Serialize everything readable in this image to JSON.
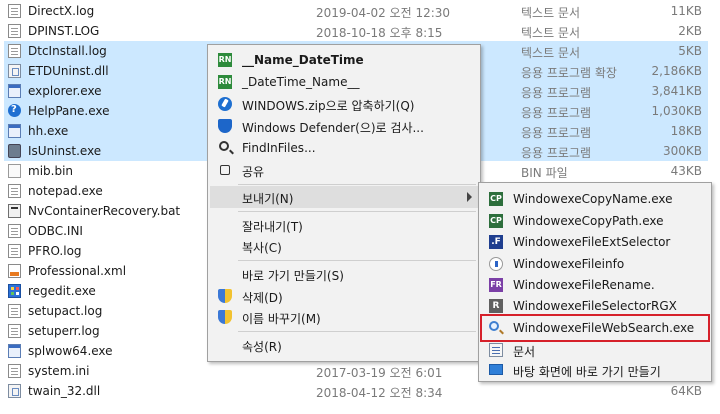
{
  "files": [
    {
      "name": "DirectX.log",
      "date": "2019-04-02 오전 12:30",
      "type": "텍스트 문서",
      "size": "11KB",
      "icon": "text-file-icon",
      "selected": false
    },
    {
      "name": "DPINST.LOG",
      "date": "2018-10-18 오후 8:15",
      "type": "텍스트 문서",
      "size": "2KB",
      "icon": "text-file-icon",
      "selected": false
    },
    {
      "name": "DtcInstall.log",
      "date": "",
      "type": "텍스트 문서",
      "size": "5KB",
      "icon": "text-file-icon",
      "selected": true
    },
    {
      "name": "ETDUninst.dll",
      "date": "",
      "type": "응용 프로그램 확장",
      "size": "2,186KB",
      "icon": "dll-file-icon",
      "selected": true
    },
    {
      "name": "explorer.exe",
      "date": "",
      "type": "응용 프로그램",
      "size": "3,841KB",
      "icon": "explorer-icon",
      "selected": true
    },
    {
      "name": "HelpPane.exe",
      "date": "",
      "type": "응용 프로그램",
      "size": "1,030KB",
      "icon": "help-icon",
      "selected": true
    },
    {
      "name": "hh.exe",
      "date": "",
      "type": "응용 프로그램",
      "size": "18KB",
      "icon": "exe-file-icon",
      "selected": true
    },
    {
      "name": "IsUninst.exe",
      "date": "",
      "type": "응용 프로그램",
      "size": "300KB",
      "icon": "setup-icon",
      "selected": true
    },
    {
      "name": "mib.bin",
      "date": "",
      "type": "BIN 파일",
      "size": "43KB",
      "icon": "bin-file-icon",
      "selected": false
    },
    {
      "name": "notepad.exe",
      "date": "",
      "type": "",
      "size": "",
      "icon": "notepad-icon",
      "selected": false
    },
    {
      "name": "NvContainerRecovery.bat",
      "date": "",
      "type": "",
      "size": "",
      "icon": "batch-file-icon",
      "selected": false
    },
    {
      "name": "ODBC.INI",
      "date": "",
      "type": "",
      "size": "",
      "icon": "config-file-icon",
      "selected": false
    },
    {
      "name": "PFRO.log",
      "date": "",
      "type": "",
      "size": "",
      "icon": "text-file-icon",
      "selected": false
    },
    {
      "name": "Professional.xml",
      "date": "",
      "type": "",
      "size": "",
      "icon": "xml-file-icon",
      "selected": false
    },
    {
      "name": "regedit.exe",
      "date": "",
      "type": "",
      "size": "",
      "icon": "regedit-icon",
      "selected": false
    },
    {
      "name": "setupact.log",
      "date": "",
      "type": "",
      "size": "",
      "icon": "text-file-icon",
      "selected": false
    },
    {
      "name": "setuperr.log",
      "date": "",
      "type": "",
      "size": "",
      "icon": "text-file-icon",
      "selected": false
    },
    {
      "name": "splwow64.exe",
      "date": "",
      "type": "",
      "size": "",
      "icon": "printer-exe-icon",
      "selected": false
    },
    {
      "name": "system.ini",
      "date": "2017-03-19 오전 6:01",
      "type": "",
      "size": "",
      "icon": "config-file-icon",
      "selected": false
    },
    {
      "name": "twain_32.dll",
      "date": "2018-04-12 오전 8:34",
      "type": "",
      "size": "64KB",
      "icon": "dll-file-icon",
      "selected": false
    }
  ],
  "context_menu": {
    "items": [
      {
        "label": "__Name_DateTime",
        "icon": "rn-icon",
        "bold": true
      },
      {
        "label": "_DateTime_Name__",
        "icon": "rn-icon"
      },
      {
        "label": "WINDOWS.zip으로 압축하기(Q)",
        "icon": "winzip-icon"
      },
      {
        "label": "Windows Defender(으)로 검사...",
        "icon": "defender-icon"
      },
      {
        "label": "FindInFiles...",
        "icon": "find-icon"
      },
      {
        "label": "공유",
        "icon": "share-icon"
      },
      {
        "label": "보내기(N)",
        "icon": "",
        "submenu": true
      },
      {
        "label": "잘라내기(T)",
        "icon": ""
      },
      {
        "label": "복사(C)",
        "icon": ""
      },
      {
        "label": "바로 가기 만들기(S)",
        "icon": ""
      },
      {
        "label": "삭제(D)",
        "icon": "shield-icon"
      },
      {
        "label": "이름 바꾸기(M)",
        "icon": "shield-icon"
      },
      {
        "label": "속성(R)",
        "icon": ""
      }
    ]
  },
  "sendto_menu": {
    "items": [
      {
        "label": "WindowexeCopyName.exe",
        "icon": "cp-icon",
        "icon_text": "CP"
      },
      {
        "label": "WindowexeCopyPath.exe",
        "icon": "cp-icon",
        "icon_text": "CP"
      },
      {
        "label": "WindowexeFileExtSelector",
        "icon": "f-icon",
        "icon_text": ".F"
      },
      {
        "label": "WindowexeFileinfo",
        "icon": "info-icon",
        "icon_text": ""
      },
      {
        "label": "WindowexeFileRename.",
        "icon": "fr-icon",
        "icon_text": "FR"
      },
      {
        "label": "WindowexeFileSelectorRGX",
        "icon": "r-icon",
        "icon_text": "R"
      },
      {
        "label": "WindowexeFileWebSearch.exe",
        "icon": "magnify-icon",
        "icon_text": "",
        "highlighted": true
      },
      {
        "label": "문서",
        "icon": "documents-icon",
        "icon_text": ""
      },
      {
        "label": "바탕 화면에 바로 가기 만들기",
        "icon": "desktop-icon",
        "icon_text": ""
      }
    ]
  },
  "colors": {
    "selection": "#cce8ff",
    "highlight_box": "#d6202a",
    "menu_bg": "#f2f2f2"
  }
}
